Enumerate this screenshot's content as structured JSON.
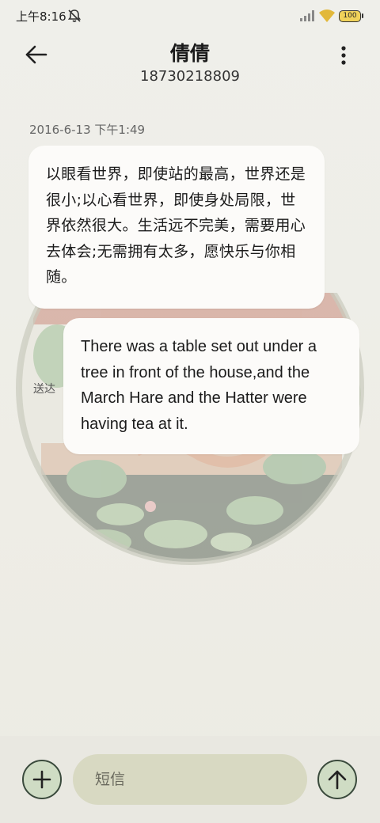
{
  "status_bar": {
    "time": "上午8:16",
    "battery": "100",
    "icons": [
      "bell-muted-icon",
      "signal-icon",
      "wifi-icon",
      "battery-icon"
    ]
  },
  "header": {
    "contact_name": "倩倩",
    "contact_phone": "18730218809",
    "icons": [
      "back-arrow-icon",
      "more-vertical-icon"
    ]
  },
  "conversation": {
    "timestamp": "2016-6-13 下午1:49",
    "messages": [
      {
        "direction": "incoming",
        "text": "以眼看世界，即使站的最高，世界还是很小;以心看世界，即使身处局限，世界依然很大。生活远不完美，需要用心去体会;无需拥有太多，愿快乐与你相随。"
      },
      {
        "direction": "outgoing",
        "text": "There was a table set out under a tree in front of the house,and the March Hare and the Hatter were having tea at it.",
        "status": "送达"
      }
    ]
  },
  "composer": {
    "placeholder": "短信",
    "value": "",
    "icons": [
      "add-icon",
      "send-arrow-icon"
    ]
  },
  "colors": {
    "accent_button": "#cfdcc4",
    "input_background": "#d8d9c2",
    "page_background": "#eeede6"
  }
}
